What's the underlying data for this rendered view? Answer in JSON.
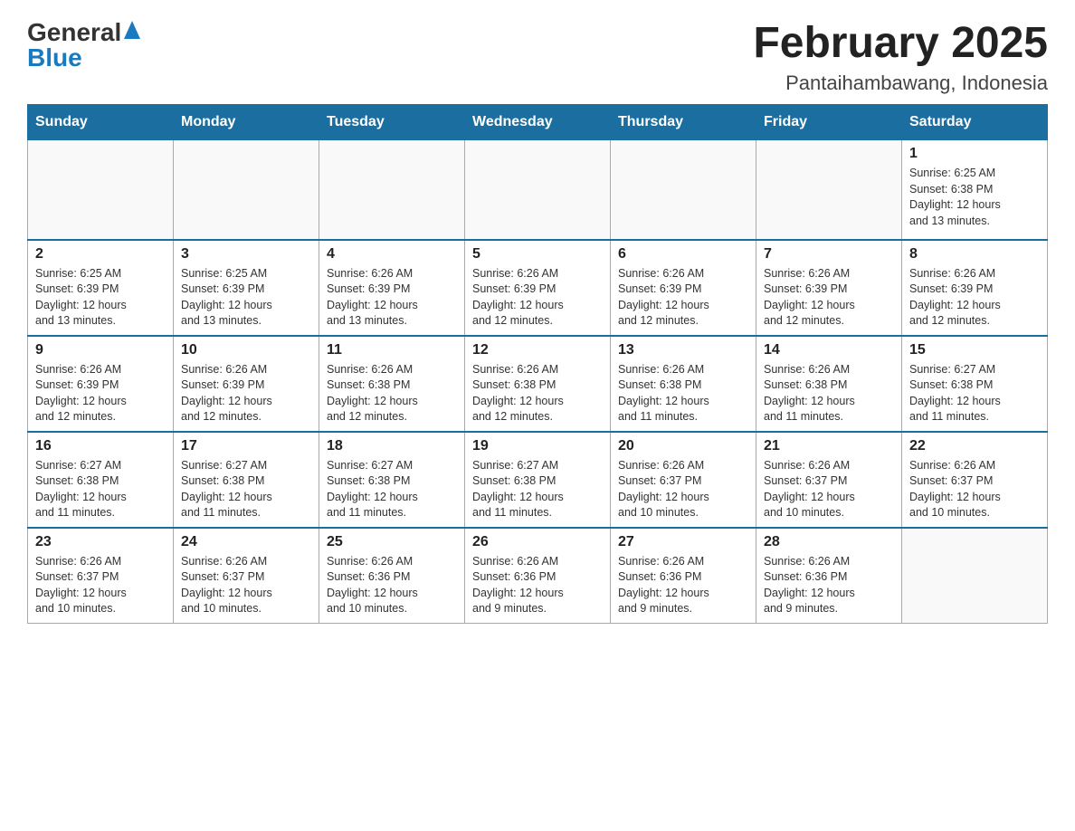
{
  "header": {
    "logo_line1": "General",
    "logo_line2": "Blue",
    "title": "February 2025",
    "subtitle": "Pantaihambawang, Indonesia"
  },
  "weekdays": [
    "Sunday",
    "Monday",
    "Tuesday",
    "Wednesday",
    "Thursday",
    "Friday",
    "Saturday"
  ],
  "weeks": [
    [
      {
        "day": "",
        "info": ""
      },
      {
        "day": "",
        "info": ""
      },
      {
        "day": "",
        "info": ""
      },
      {
        "day": "",
        "info": ""
      },
      {
        "day": "",
        "info": ""
      },
      {
        "day": "",
        "info": ""
      },
      {
        "day": "1",
        "info": "Sunrise: 6:25 AM\nSunset: 6:38 PM\nDaylight: 12 hours\nand 13 minutes."
      }
    ],
    [
      {
        "day": "2",
        "info": "Sunrise: 6:25 AM\nSunset: 6:39 PM\nDaylight: 12 hours\nand 13 minutes."
      },
      {
        "day": "3",
        "info": "Sunrise: 6:25 AM\nSunset: 6:39 PM\nDaylight: 12 hours\nand 13 minutes."
      },
      {
        "day": "4",
        "info": "Sunrise: 6:26 AM\nSunset: 6:39 PM\nDaylight: 12 hours\nand 13 minutes."
      },
      {
        "day": "5",
        "info": "Sunrise: 6:26 AM\nSunset: 6:39 PM\nDaylight: 12 hours\nand 12 minutes."
      },
      {
        "day": "6",
        "info": "Sunrise: 6:26 AM\nSunset: 6:39 PM\nDaylight: 12 hours\nand 12 minutes."
      },
      {
        "day": "7",
        "info": "Sunrise: 6:26 AM\nSunset: 6:39 PM\nDaylight: 12 hours\nand 12 minutes."
      },
      {
        "day": "8",
        "info": "Sunrise: 6:26 AM\nSunset: 6:39 PM\nDaylight: 12 hours\nand 12 minutes."
      }
    ],
    [
      {
        "day": "9",
        "info": "Sunrise: 6:26 AM\nSunset: 6:39 PM\nDaylight: 12 hours\nand 12 minutes."
      },
      {
        "day": "10",
        "info": "Sunrise: 6:26 AM\nSunset: 6:39 PM\nDaylight: 12 hours\nand 12 minutes."
      },
      {
        "day": "11",
        "info": "Sunrise: 6:26 AM\nSunset: 6:38 PM\nDaylight: 12 hours\nand 12 minutes."
      },
      {
        "day": "12",
        "info": "Sunrise: 6:26 AM\nSunset: 6:38 PM\nDaylight: 12 hours\nand 12 minutes."
      },
      {
        "day": "13",
        "info": "Sunrise: 6:26 AM\nSunset: 6:38 PM\nDaylight: 12 hours\nand 11 minutes."
      },
      {
        "day": "14",
        "info": "Sunrise: 6:26 AM\nSunset: 6:38 PM\nDaylight: 12 hours\nand 11 minutes."
      },
      {
        "day": "15",
        "info": "Sunrise: 6:27 AM\nSunset: 6:38 PM\nDaylight: 12 hours\nand 11 minutes."
      }
    ],
    [
      {
        "day": "16",
        "info": "Sunrise: 6:27 AM\nSunset: 6:38 PM\nDaylight: 12 hours\nand 11 minutes."
      },
      {
        "day": "17",
        "info": "Sunrise: 6:27 AM\nSunset: 6:38 PM\nDaylight: 12 hours\nand 11 minutes."
      },
      {
        "day": "18",
        "info": "Sunrise: 6:27 AM\nSunset: 6:38 PM\nDaylight: 12 hours\nand 11 minutes."
      },
      {
        "day": "19",
        "info": "Sunrise: 6:27 AM\nSunset: 6:38 PM\nDaylight: 12 hours\nand 11 minutes."
      },
      {
        "day": "20",
        "info": "Sunrise: 6:26 AM\nSunset: 6:37 PM\nDaylight: 12 hours\nand 10 minutes."
      },
      {
        "day": "21",
        "info": "Sunrise: 6:26 AM\nSunset: 6:37 PM\nDaylight: 12 hours\nand 10 minutes."
      },
      {
        "day": "22",
        "info": "Sunrise: 6:26 AM\nSunset: 6:37 PM\nDaylight: 12 hours\nand 10 minutes."
      }
    ],
    [
      {
        "day": "23",
        "info": "Sunrise: 6:26 AM\nSunset: 6:37 PM\nDaylight: 12 hours\nand 10 minutes."
      },
      {
        "day": "24",
        "info": "Sunrise: 6:26 AM\nSunset: 6:37 PM\nDaylight: 12 hours\nand 10 minutes."
      },
      {
        "day": "25",
        "info": "Sunrise: 6:26 AM\nSunset: 6:36 PM\nDaylight: 12 hours\nand 10 minutes."
      },
      {
        "day": "26",
        "info": "Sunrise: 6:26 AM\nSunset: 6:36 PM\nDaylight: 12 hours\nand 9 minutes."
      },
      {
        "day": "27",
        "info": "Sunrise: 6:26 AM\nSunset: 6:36 PM\nDaylight: 12 hours\nand 9 minutes."
      },
      {
        "day": "28",
        "info": "Sunrise: 6:26 AM\nSunset: 6:36 PM\nDaylight: 12 hours\nand 9 minutes."
      },
      {
        "day": "",
        "info": ""
      }
    ]
  ]
}
